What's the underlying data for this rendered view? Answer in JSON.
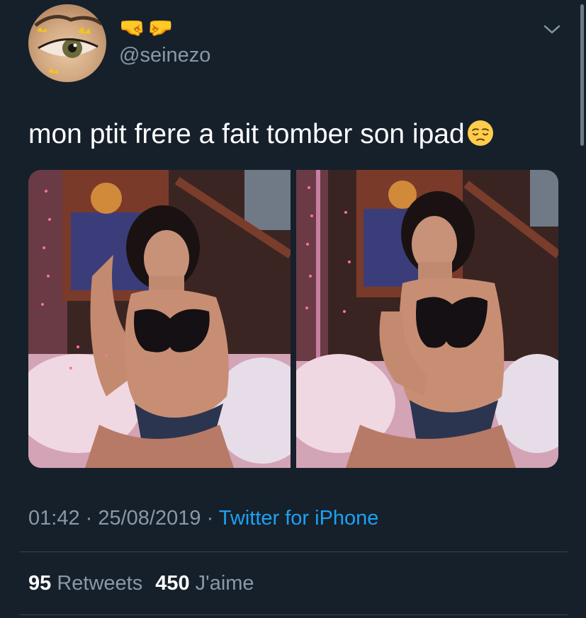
{
  "tweet": {
    "display_name": "🤜🤛",
    "username": "@seinezo",
    "text": "mon ptit frere a fait tomber son ipad",
    "emoji": "pensive-face",
    "timestamp": {
      "time": "01:42",
      "separator_1": " · ",
      "date": "25/08/2019",
      "separator_2": " · ",
      "source": "Twitter for iPhone"
    },
    "stats": {
      "retweets_count": "95",
      "retweets_label": "Retweets",
      "likes_count": "450",
      "likes_label": "J'aime"
    },
    "media_count": 2
  },
  "icons": {
    "menu": "chevron-down-icon"
  },
  "colors": {
    "background": "#15202b",
    "text_primary": "#ffffff",
    "text_secondary": "#8b98a5",
    "link": "#1da1f2",
    "divider": "#38444d"
  }
}
